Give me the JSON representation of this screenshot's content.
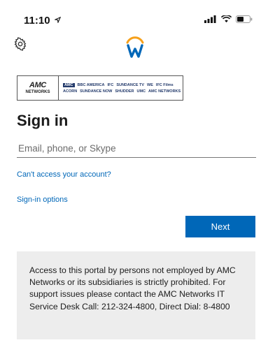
{
  "status_bar": {
    "time": "11:10",
    "location_icon": "location-arrow-icon",
    "icons": [
      "signal-icon",
      "wifi-icon",
      "battery-icon"
    ]
  },
  "header": {
    "settings_icon": "gear-icon",
    "logo": "workday-logo",
    "accent_color": "#f6a01a",
    "logo_color": "#0067b8"
  },
  "banner": {
    "amc_top": "AMC",
    "amc_bottom": "NETWORKS",
    "row1": [
      "AMC",
      "BBC AMERICA",
      "IFC",
      "SUNDANCE TV",
      "WE",
      "IFC Films"
    ],
    "row2": [
      "ACORN",
      "SUNDANCE NOW",
      "SHUDDER",
      "UMC",
      "AMC NETWORKS"
    ]
  },
  "signin": {
    "title": "Sign in",
    "email_placeholder": "Email, phone, or Skype",
    "email_value": "",
    "cant_access_label": "Can't access your account?",
    "signin_options_label": "Sign-in options",
    "next_label": "Next"
  },
  "notice": {
    "text": "Access to this portal by persons not employed by AMC Networks or its subsidiaries is strictly prohibited. For support issues please contact the AMC Networks IT Service Desk Call: 212-324-4800, Direct Dial: 8-4800"
  },
  "colors": {
    "primary": "#0067b8",
    "notice_bg": "#ededed",
    "text": "#1b1b1b"
  }
}
